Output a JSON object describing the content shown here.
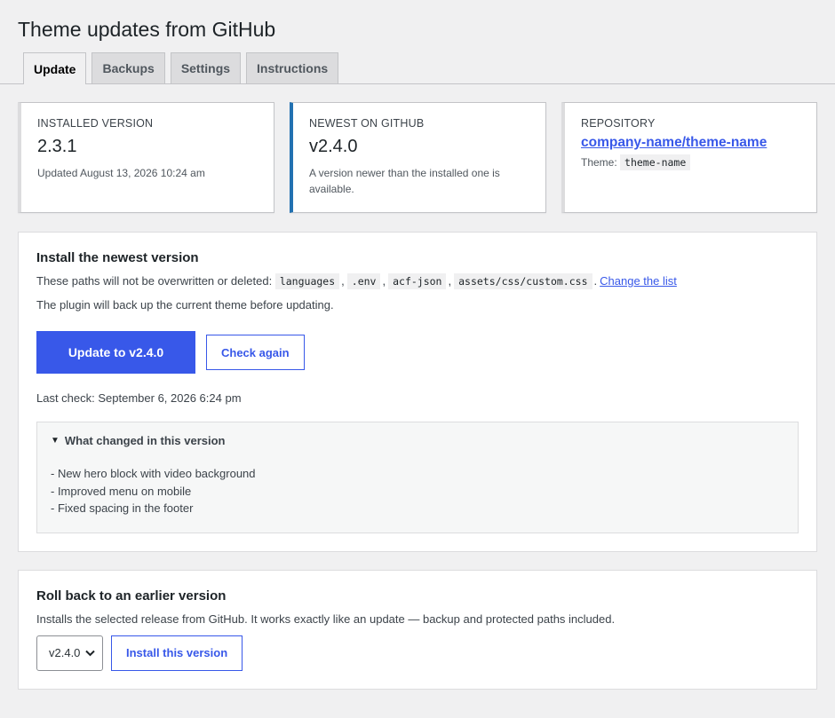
{
  "page": {
    "title": "Theme updates from GitHub"
  },
  "tabs": [
    {
      "label": "Update",
      "active": true
    },
    {
      "label": "Backups",
      "active": false
    },
    {
      "label": "Settings",
      "active": false
    },
    {
      "label": "Instructions",
      "active": false
    }
  ],
  "cards": {
    "installed": {
      "label": "INSTALLED VERSION",
      "value": "2.3.1",
      "note": "Updated August 13, 2026 10:24 am"
    },
    "newest": {
      "label": "NEWEST ON GITHUB",
      "value": "v2.4.0",
      "note": "A version newer than the installed one is available."
    },
    "repository": {
      "label": "REPOSITORY",
      "link": "company-name/theme-name",
      "theme_label": "Theme:",
      "theme_value": "theme-name"
    }
  },
  "install": {
    "heading": "Install the newest version",
    "protected_text": "These paths will not be overwritten or deleted:",
    "paths": [
      "languages",
      ".env",
      "acf-json",
      "assets/css/custom.css"
    ],
    "path_separator": ",",
    "path_end": ".",
    "change_list_link": "Change the list",
    "backup_note": "The plugin will back up the current theme before updating.",
    "update_button": "Update to v2.4.0",
    "check_button": "Check again",
    "last_check": "Last check: September 6, 2026 6:24 pm",
    "changes_summary": "What changed in this version",
    "changes": [
      "- New hero block with video background",
      "- Improved menu on mobile",
      "- Fixed spacing in the footer"
    ]
  },
  "rollback": {
    "heading": "Roll back to an earlier version",
    "description": "Installs the selected release from GitHub. It works exactly like an update — backup and protected paths included.",
    "selected_version": "v2.4.0",
    "install_button": "Install this version"
  },
  "icons": {
    "details_toggle": "triangle-down-icon",
    "select_arrow": "chevron-down-icon"
  },
  "colors": {
    "accent": "#3858e9",
    "highlight_border": "#2271b1"
  }
}
